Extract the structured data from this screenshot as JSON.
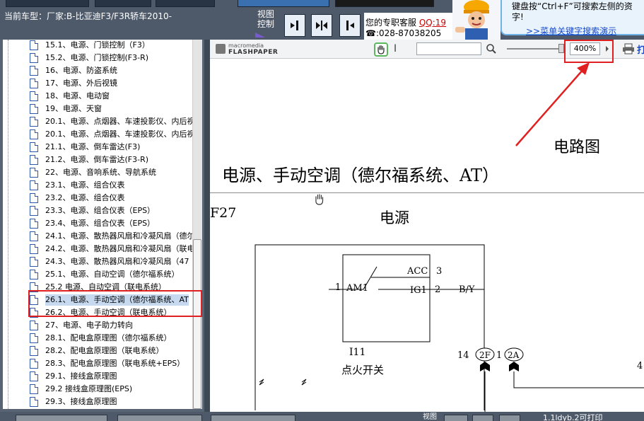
{
  "app": {
    "current_car_label": "当前车型：厂家:B-比亚迪F3/F3R轿车2010-",
    "view_control_label": "视图\n控制"
  },
  "service": {
    "line1_prefix": "您的专职客服",
    "qq_label": "QQ:19",
    "phone": "028-87038205"
  },
  "hint": {
    "text": "键盘按“Ctrl+F”可搜索左侧的资字!",
    "link": ">>菜单关键字搜索演示"
  },
  "tree": {
    "selected_index": 20,
    "items": [
      "15.1、电源、门锁控制（F3）",
      "15.2、电源、门锁控制(F3-R)",
      "16、电源、防盗系统",
      "17、电源、外后视镜",
      "18、电源、电动窗",
      "19、电源、天窗",
      "20.1、电源、点烟器、车速投影仪、内后视",
      "20.1、电源、点烟器、车速投影仪、内后视",
      "21.1、电源、倒车雷达(F3)",
      "21.2、电源、倒车雷达(F3-R)",
      "22、电源、音响系统、导航系统",
      "23.1、电源、组合仪表",
      "23.2、电源、组合仪表",
      "23.3、电源、组合仪表（EPS）",
      "23.4、电源、组合仪表（EPS）",
      "24.1、电源、散热器风扇和冷凝风扇（德尔",
      "24.2、电源、散热器风扇和冷凝风扇（联电",
      "24.3、电源、散热器风扇和冷凝风扇（47",
      "25.1、电源、自动空调（德尔福系统）",
      "25.2 电源、自动空调（联电系统）",
      "26.1、电源、手动空调（德尔福系统、AT",
      "26.2、电源、手动空调（联电系统）",
      "27、电源、电子助力转向",
      "28.1、配电盒原理图（德尔福系统）",
      "28.2、配电盒原理图（联电系统）",
      "28.3、配电盒原理图（联电系统+EPS）",
      "29.1、接线盒原理图",
      "29.2 接线盒原理图(EPS)",
      "29.3、接线盒原理图"
    ]
  },
  "viewer": {
    "logo_top": "macromedia",
    "logo_bottom": "FLASHPAPER",
    "zoom_value": "400%",
    "print_label": "打"
  },
  "document": {
    "title": "电源、手动空调（德尔福系统、AT）",
    "code": "F27",
    "heading": "电源",
    "switch_id": "I11",
    "switch_name": "点火开关",
    "pin_am1": "AM1",
    "pin_acc": "ACC",
    "pin_ig1": "IG1",
    "pin1": "1",
    "pin2": "2",
    "pin3": "3",
    "wire_color": "B/Y",
    "conn_14": "14",
    "conn_2f": "2F",
    "conn_1": "1",
    "conn_2a": "2A",
    "edge_num": "4"
  },
  "annotation": {
    "callout": "电路图"
  },
  "bottom": {
    "view_label": "视图",
    "status": "1.1ldyb.2可打印"
  },
  "colors": {
    "frame": "#4e5a6a",
    "highlight": "#e02020",
    "link": "#1749c8"
  }
}
